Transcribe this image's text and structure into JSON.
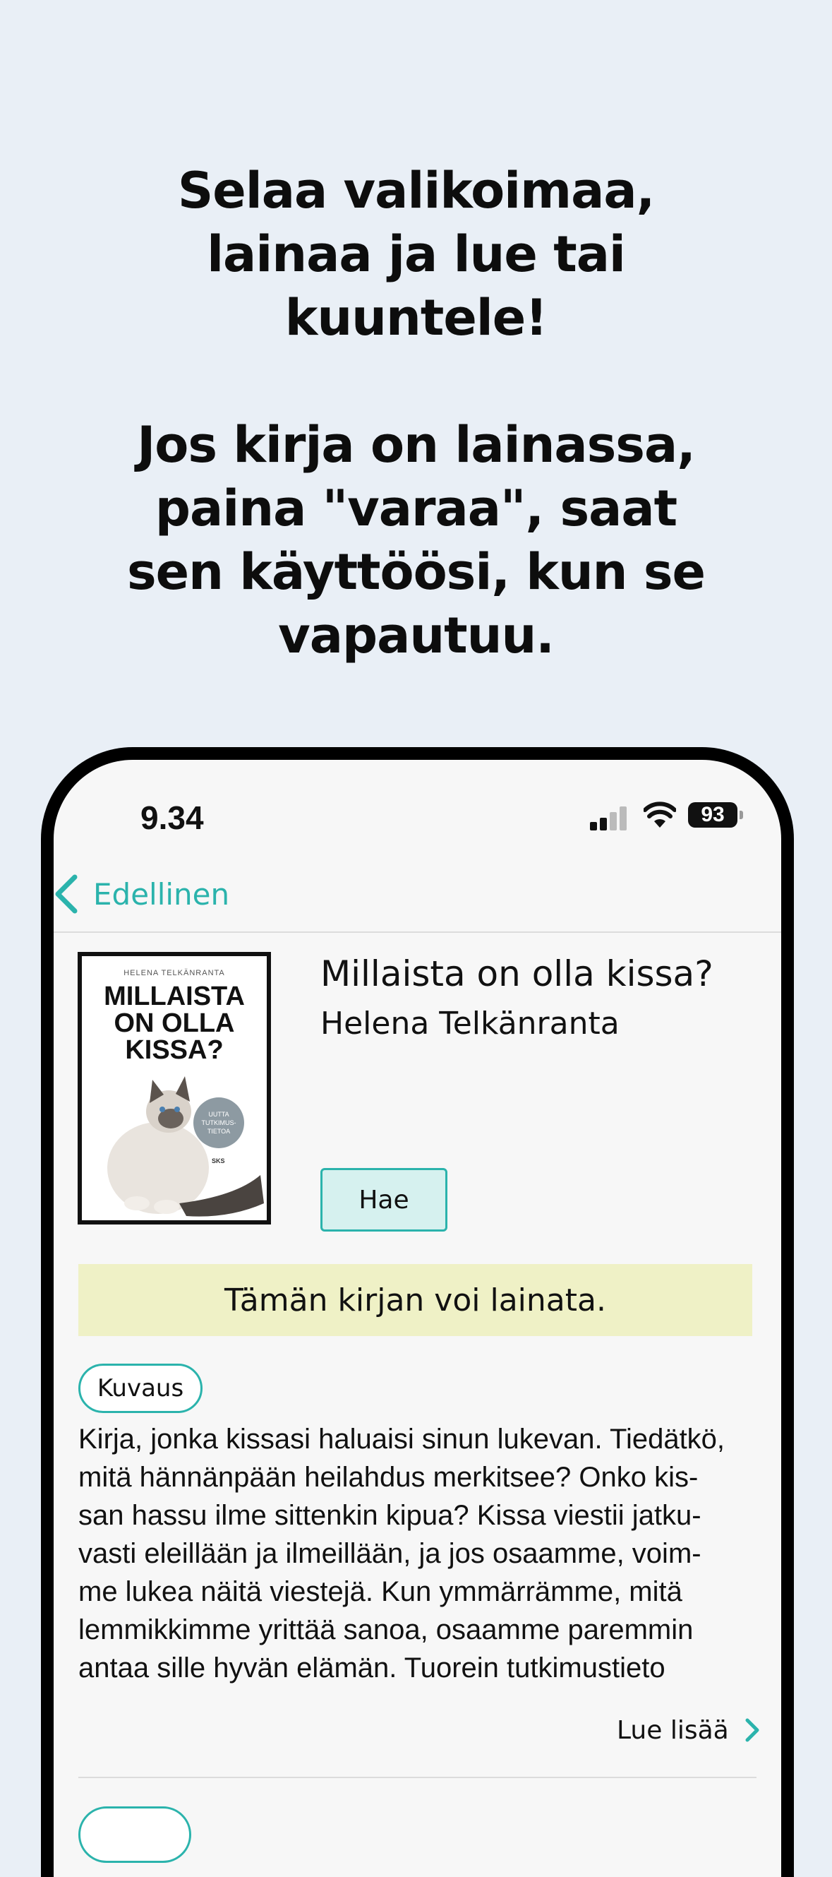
{
  "promo": {
    "line1": "Selaa valikoimaa,",
    "line2": "lainaa ja lue tai",
    "line3": "kuuntele!",
    "line4": "Jos kirja on lainassa,",
    "line5": "paina \"varaa\", saat",
    "line6": "sen käyttöösi, kun se",
    "line7": "vapautuu."
  },
  "status_bar": {
    "time": "9.34",
    "battery": "93"
  },
  "nav": {
    "back_label": "Edellinen"
  },
  "book": {
    "title": "Millaista on olla kissa?",
    "author": "Helena Telkänranta",
    "cover": {
      "author": "HELENA TELKÄNRANTA",
      "title_line1": "MILLAISTA",
      "title_line2": "ON OLLA",
      "title_line3": "KISSA?",
      "seal_line1": "UUTTA",
      "seal_line2": "TUTKIMUS-",
      "seal_line3": "TIETOA",
      "publisher": "SKS"
    },
    "action_label": "Hae",
    "availability": "Tämän kirjan voi lainata."
  },
  "description": {
    "chip_label": "Kuvaus",
    "lines": [
      "Kirja, jonka kissasi haluaisi sinun lukevan. Tiedätkö,",
      "mitä hännänpään heilahdus merkitsee? Onko kis-",
      "san hassu ilme sittenkin kipua? Kissa viestii jatku-",
      "vasti eleillään ja ilmeillään, ja jos osaamme, voim-",
      "me lukea näitä viestejä. Kun ymmärrämme, mitä",
      "lemmikkimme yrittää sanoa, osaamme paremmin",
      "antaa sille hyvän elämän. Tuorein tutkimustieto"
    ],
    "read_more": "Lue lisää"
  },
  "colors": {
    "background": "#e9eff6",
    "accent": "#2bb3ac",
    "availability_bg": "#eff1c6",
    "button_bg": "#d6f1ef"
  },
  "icons": [
    "chevron-left-icon",
    "cellular-signal-icon",
    "wifi-icon",
    "battery-icon",
    "chevron-right-icon"
  ]
}
